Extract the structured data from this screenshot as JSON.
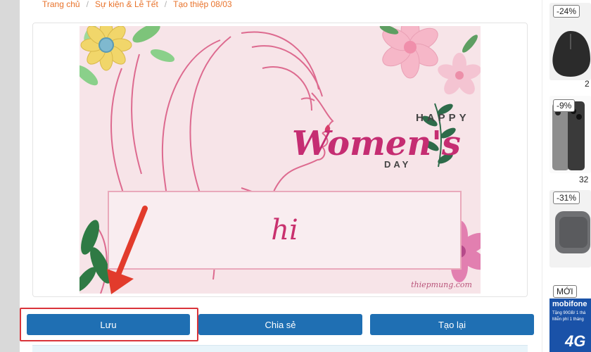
{
  "breadcrumb": {
    "items": [
      "Trang chủ",
      "Sự kiện & Lễ Tết",
      "Tạo thiệp 08/03"
    ],
    "separator": "/"
  },
  "card": {
    "heading_small_top": "HAPPY",
    "heading_script": "Women's",
    "heading_small_bottom": "DAY",
    "message": "hi",
    "watermark": "thiepmung.com"
  },
  "buttons": {
    "save_label": "Lưu",
    "share_label": "Chia sẻ",
    "remake_label": "Tạo lại"
  },
  "sidebar": {
    "products": [
      {
        "discount": "-24%",
        "price_stub": "2"
      },
      {
        "discount": "-9%",
        "price_stub": "32"
      },
      {
        "discount": "-31%",
        "price_stub": ""
      }
    ],
    "new_label": "MỚI",
    "ad": {
      "brand": "mobifone",
      "line1": "Tặng 90GB/ 1 thá",
      "line2": "Miễn phí 1 tháng",
      "big": "4G"
    }
  },
  "colors": {
    "button_blue": "#1f6fb3",
    "highlight_red": "#d9343a",
    "link_orange": "#e8722a",
    "card_pink": "#f7e4e8",
    "script_pink": "#c9316e"
  }
}
